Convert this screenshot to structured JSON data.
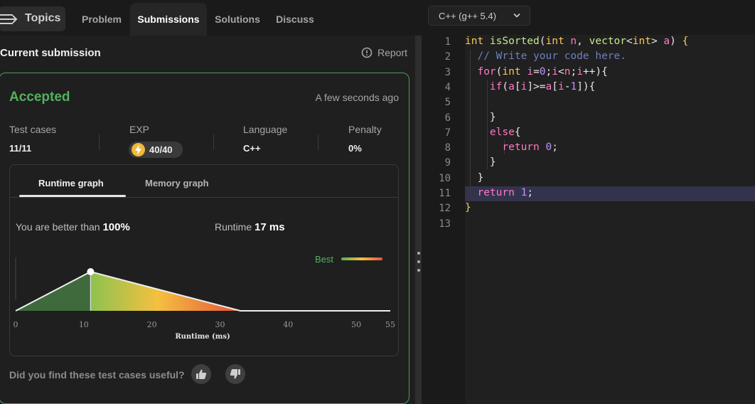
{
  "tabs": {
    "topics": "Topics",
    "items": [
      "Problem",
      "Submissions",
      "Solutions",
      "Discuss"
    ],
    "active": "Submissions"
  },
  "submission": {
    "title": "Current submission",
    "report": "Report",
    "status": "Accepted",
    "time": "A few seconds ago",
    "stats": {
      "test_cases_label": "Test cases",
      "test_cases_value": "11/11",
      "exp_label": "EXP",
      "exp_value": "40/40",
      "language_label": "Language",
      "language_value": "C++",
      "penalty_label": "Penalty",
      "penalty_value": "0%"
    },
    "graph_tabs": [
      "Runtime graph",
      "Memory graph"
    ],
    "better_label": "You are better than",
    "better_value": "100%",
    "runtime_label": "Runtime",
    "runtime_value": "17 ms",
    "feedback": "Did you find these test cases useful?"
  },
  "chart_data": {
    "type": "area",
    "xlabel": "Runtime (ms)",
    "ylabel": "",
    "x_ticks": [
      0,
      10,
      20,
      30,
      40,
      50,
      55
    ],
    "xlim": [
      0,
      55
    ],
    "x": [
      0,
      11,
      33,
      55
    ],
    "y": [
      0,
      1,
      0,
      0
    ],
    "highlight_x": 11,
    "legend": "Best",
    "colors": {
      "left": "#3f6a3c",
      "mid": "#8dc24f",
      "peak": "#f5c040",
      "end": "#e5533b",
      "legend_text": "#53b15d"
    }
  },
  "editor": {
    "language": "C++ (g++ 5.4)",
    "line_numbers": [
      "1",
      "2",
      "3",
      "4",
      "5",
      "6",
      "7",
      "8",
      "9",
      "10",
      "11",
      "12",
      "13"
    ],
    "highlight_line": 11,
    "lines": [
      [
        {
          "t": "int ",
          "c": "ty"
        },
        {
          "t": "isSorted",
          "c": "fn"
        },
        {
          "t": "(",
          "c": "pl"
        },
        {
          "t": "int ",
          "c": "ty"
        },
        {
          "t": "n",
          "c": "vr"
        },
        {
          "t": ", ",
          "c": "pl"
        },
        {
          "t": "vector",
          "c": "fn"
        },
        {
          "t": "<",
          "c": "pl"
        },
        {
          "t": "int",
          "c": "ty"
        },
        {
          "t": "> ",
          "c": "pl"
        },
        {
          "t": "a",
          "c": "vr"
        },
        {
          "t": ") ",
          "c": "pl"
        },
        {
          "t": "{",
          "c": "br"
        }
      ],
      [
        {
          "t": "  // Write your code here.",
          "c": "cm"
        }
      ],
      [
        {
          "t": "  ",
          "c": "pl"
        },
        {
          "t": "for",
          "c": "kw"
        },
        {
          "t": "(",
          "c": "pl"
        },
        {
          "t": "int ",
          "c": "ty"
        },
        {
          "t": "i",
          "c": "vr"
        },
        {
          "t": "=",
          "c": "pl"
        },
        {
          "t": "0",
          "c": "num"
        },
        {
          "t": ";",
          "c": "pl"
        },
        {
          "t": "i",
          "c": "vr"
        },
        {
          "t": "<",
          "c": "pl"
        },
        {
          "t": "n",
          "c": "vr"
        },
        {
          "t": ";",
          "c": "pl"
        },
        {
          "t": "i",
          "c": "vr"
        },
        {
          "t": "++){",
          "c": "pl"
        }
      ],
      [
        {
          "t": "    ",
          "c": "pl"
        },
        {
          "t": "if",
          "c": "kw"
        },
        {
          "t": "(",
          "c": "pl"
        },
        {
          "t": "a",
          "c": "vr"
        },
        {
          "t": "[",
          "c": "pl"
        },
        {
          "t": "i",
          "c": "vr"
        },
        {
          "t": "]>=",
          "c": "pl"
        },
        {
          "t": "a",
          "c": "vr"
        },
        {
          "t": "[",
          "c": "pl"
        },
        {
          "t": "i",
          "c": "vr"
        },
        {
          "t": "-",
          "c": "pl"
        },
        {
          "t": "1",
          "c": "num"
        },
        {
          "t": "]){",
          "c": "pl"
        }
      ],
      [
        {
          "t": "",
          "c": "pl"
        }
      ],
      [
        {
          "t": "    }",
          "c": "pl"
        }
      ],
      [
        {
          "t": "    ",
          "c": "pl"
        },
        {
          "t": "else",
          "c": "kw"
        },
        {
          "t": "{",
          "c": "pl"
        }
      ],
      [
        {
          "t": "      ",
          "c": "pl"
        },
        {
          "t": "return ",
          "c": "kw"
        },
        {
          "t": "0",
          "c": "num"
        },
        {
          "t": ";",
          "c": "pl"
        }
      ],
      [
        {
          "t": "    }",
          "c": "pl"
        }
      ],
      [
        {
          "t": "  }",
          "c": "pl"
        }
      ],
      [
        {
          "t": "  ",
          "c": "pl"
        },
        {
          "t": "return ",
          "c": "kw"
        },
        {
          "t": "1",
          "c": "num"
        },
        {
          "t": ";",
          "c": "pl"
        }
      ],
      [
        {
          "t": "}",
          "c": "br"
        }
      ],
      [
        {
          "t": "",
          "c": "pl"
        }
      ]
    ]
  }
}
